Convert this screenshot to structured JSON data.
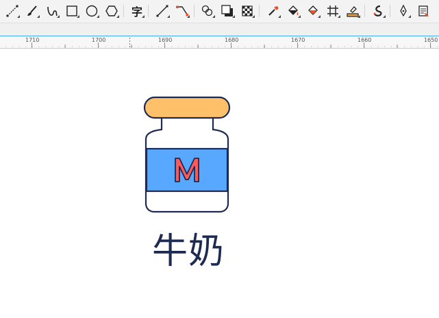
{
  "toolbar": {
    "tools": [
      {
        "icon": "bezier-curve-icon"
      },
      {
        "icon": "brush-icon"
      },
      {
        "icon": "freehand-icon"
      },
      {
        "icon": "rectangle-icon"
      },
      {
        "icon": "ellipse-icon"
      },
      {
        "icon": "polygon-icon"
      },
      {
        "icon": "text-icon",
        "label": "字"
      },
      {
        "icon": "line-connector-icon"
      },
      {
        "icon": "dimension-icon"
      },
      {
        "icon": "blend-icon"
      },
      {
        "icon": "drop-shadow-icon"
      },
      {
        "icon": "transparency-icon"
      },
      {
        "icon": "eyedropper-icon"
      },
      {
        "icon": "fill-icon"
      },
      {
        "icon": "smart-fill-icon"
      },
      {
        "icon": "mesh-grid-icon"
      },
      {
        "icon": "interactive-fill-icon"
      },
      {
        "icon": "smudge-icon"
      },
      {
        "icon": "pen-icon"
      },
      {
        "icon": "paste-tool-icon"
      }
    ]
  },
  "ruler": {
    "labels": [
      "1710",
      "1700",
      "1690",
      "1680",
      "1670",
      "1660",
      "1650"
    ]
  },
  "canvas": {
    "illustration": {
      "icon": "milk-bottle-icon",
      "label_letter": "M",
      "colors": {
        "outline": "#1d2a52",
        "cap": "#ffc06a",
        "label_band": "#58a8ff",
        "letter": "#ff5a5a",
        "body": "#ffffff"
      }
    },
    "caption": "牛奶"
  }
}
